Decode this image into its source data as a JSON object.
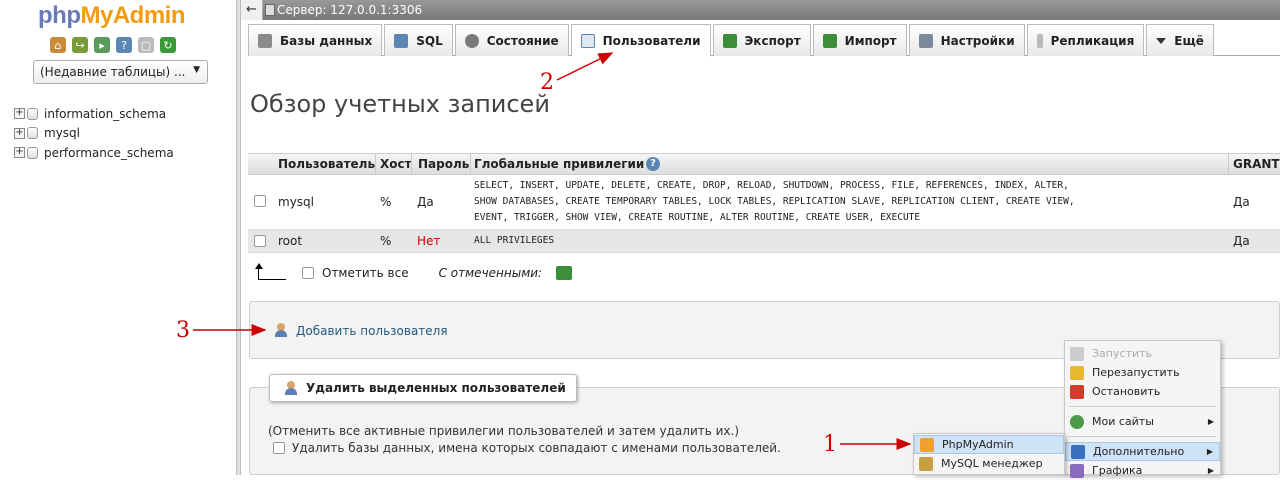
{
  "nav": {
    "logo_php": "php",
    "logo_myadmin": "MyAdmin",
    "icons": [
      "home-icon",
      "exit-icon",
      "query-window-icon",
      "docs-icon",
      "sql-docs-icon",
      "reload-icon"
    ],
    "recent_tables": "(Недавние таблицы) ...",
    "databases": [
      "information_schema",
      "mysql",
      "performance_schema"
    ]
  },
  "server_bar": {
    "back": "←",
    "server_label": "Сервер: 127.0.0.1:3306"
  },
  "tabs": [
    {
      "label": "Базы данных",
      "icon": "database-icon",
      "color": "#8a8a8a"
    },
    {
      "label": "SQL",
      "icon": "sql-icon",
      "color": "#5c87b2"
    },
    {
      "label": "Состояние",
      "icon": "status-icon",
      "color": "#7a7a7a"
    },
    {
      "label": "Пользователи",
      "icon": "users-icon",
      "color": "#5c87b2",
      "active": true
    },
    {
      "label": "Экспорт",
      "icon": "export-icon",
      "color": "#3b8f3b"
    },
    {
      "label": "Импорт",
      "icon": "import-icon",
      "color": "#3b8f3b"
    },
    {
      "label": "Настройки",
      "icon": "wrench-icon",
      "color": "#7a8a9a"
    },
    {
      "label": "Репликация",
      "icon": "replication-icon",
      "color": "#999999"
    },
    {
      "label": "Ещё",
      "icon": "dropdown-icon",
      "color": "#333333"
    }
  ],
  "page_title": "Обзор учетных записей",
  "users_table": {
    "headers": {
      "user": "Пользователь",
      "host": "Хост",
      "password": "Пароль",
      "privileges": "Глобальные привилегии",
      "grant": "GRANT"
    },
    "rows": [
      {
        "user": "mysql",
        "host": "%",
        "password": "Да",
        "privileges": [
          "SELECT, INSERT, UPDATE, DELETE, CREATE, DROP, RELOAD, SHUTDOWN, PROCESS, FILE, REFERENCES, INDEX, ALTER,",
          "SHOW DATABASES, CREATE TEMPORARY TABLES, LOCK TABLES, REPLICATION SLAVE, REPLICATION CLIENT, CREATE VIEW,",
          "EVENT, TRIGGER, SHOW VIEW, CREATE ROUTINE, ALTER ROUTINE, CREATE USER, EXECUTE"
        ],
        "grant": "Да"
      },
      {
        "user": "root",
        "host": "%",
        "password": "Нет",
        "privileges": [
          "ALL PRIVILEGES"
        ],
        "grant": "Да"
      }
    ]
  },
  "bulk": {
    "check_all": "Отметить все",
    "with_selected": "С отмеченными:"
  },
  "add_user": "Добавить пользователя",
  "delete_section": {
    "legend": "Удалить выделенных пользователей",
    "note": "(Отменить все активные привилегии пользователей и затем удалить их.)",
    "drop_db": "Удалить базы данных, имена которых совпадают с именами пользователей."
  },
  "context_menu_main": {
    "items": [
      {
        "label": "Запустить",
        "disabled": true,
        "icon": "flag-gray-icon"
      },
      {
        "label": "Перезапустить",
        "icon": "flag-yellow-icon"
      },
      {
        "label": "Остановить",
        "icon": "flag-red-icon"
      },
      {
        "label": "Мои сайты",
        "icon": "globe-icon",
        "submenu": true
      },
      {
        "label": "Дополнительно",
        "icon": "puzzle-icon",
        "submenu": true,
        "highlighted": true
      },
      {
        "label": "Графика",
        "icon": "graphics-icon",
        "submenu": true
      }
    ]
  },
  "context_menu_sub": {
    "items": [
      {
        "label": "PhpMyAdmin",
        "icon": "phpmyadmin-icon",
        "highlighted": true
      },
      {
        "label": "MySQL менеджер",
        "icon": "mysql-manager-icon"
      }
    ]
  },
  "annotations": [
    "1",
    "2",
    "3"
  ],
  "colors": {
    "link": "#235a81",
    "annotation": "#cc0000",
    "no_password": "#cc0000",
    "highlight": "#cfe3f7"
  }
}
